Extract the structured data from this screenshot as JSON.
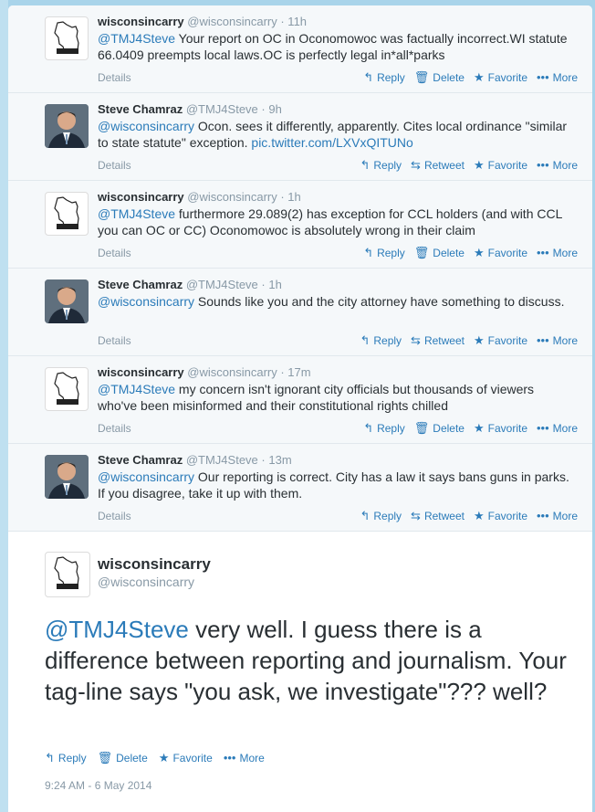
{
  "tweets": [
    {
      "name": "wisconsincarry",
      "handle": "@wisconsincarry",
      "time": "· 11h",
      "mention": "@TMJ4Steve",
      "text": " Your report on OC in Oconomowoc was factually incorrect.WI statute 66.0409 preempts local laws.OC is perfectly legal in*all*parks",
      "link": "",
      "details": "Details",
      "actions": [
        "Reply",
        "Delete",
        "Favorite",
        "More"
      ]
    },
    {
      "name": "Steve Chamraz",
      "handle": "@TMJ4Steve",
      "time": "· 9h",
      "mention": "@wisconsincarry",
      "text": " Ocon. sees it differently, apparently. Cites local ordinance \"similar to state statute\" exception. ",
      "link": "pic.twitter.com/LXVxQITUNo",
      "details": "Details",
      "actions": [
        "Reply",
        "Retweet",
        "Favorite",
        "More"
      ]
    },
    {
      "name": "wisconsincarry",
      "handle": "@wisconsincarry",
      "time": "· 1h",
      "mention": "@TMJ4Steve",
      "text": " furthermore 29.089(2) has exception for CCL holders (and with CCL you can OC or CC) Oconomowoc is absolutely wrong in their claim",
      "link": "",
      "details": "Details",
      "actions": [
        "Reply",
        "Delete",
        "Favorite",
        "More"
      ]
    },
    {
      "name": "Steve Chamraz",
      "handle": "@TMJ4Steve",
      "time": "· 1h",
      "mention": "@wisconsincarry",
      "text": " Sounds like you and the city attorney have something to discuss.",
      "link": "",
      "details": "Details",
      "actions": [
        "Reply",
        "Retweet",
        "Favorite",
        "More"
      ]
    },
    {
      "name": "wisconsincarry",
      "handle": "@wisconsincarry",
      "time": "· 17m",
      "mention": "@TMJ4Steve",
      "text": " my concern isn't ignorant city officials but thousands of viewers who've been misinformed and their constitutional rights chilled",
      "link": "",
      "details": "Details",
      "actions": [
        "Reply",
        "Delete",
        "Favorite",
        "More"
      ]
    },
    {
      "name": "Steve Chamraz",
      "handle": "@TMJ4Steve",
      "time": "· 13m",
      "mention": "@wisconsincarry",
      "text": " Our reporting is correct. City has a law it says bans guns in parks. If you disagree, take it up with them.",
      "link": "",
      "details": "Details",
      "actions": [
        "Reply",
        "Retweet",
        "Favorite",
        "More"
      ]
    }
  ],
  "main_tweet": {
    "name": "wisconsincarry",
    "handle": "@wisconsincarry",
    "mention": "@TMJ4Steve",
    "text": " very well. I guess there is a difference between reporting and journalism. Your tag-line says \"you ask, we investigate\"??? well?",
    "actions": [
      "Reply",
      "Delete",
      "Favorite",
      "More"
    ],
    "timestamp": "9:24 AM - 6 May 2014"
  },
  "icons": {
    "Reply": "reply-icon",
    "Delete": "trash-icon",
    "Retweet": "retweet-icon",
    "Favorite": "star-icon",
    "More": "more-dots-icon"
  },
  "colors": {
    "link": "#2b7bb9",
    "muted": "#8899a6",
    "text": "#292f33",
    "page_bg": "#a9d4ea"
  }
}
